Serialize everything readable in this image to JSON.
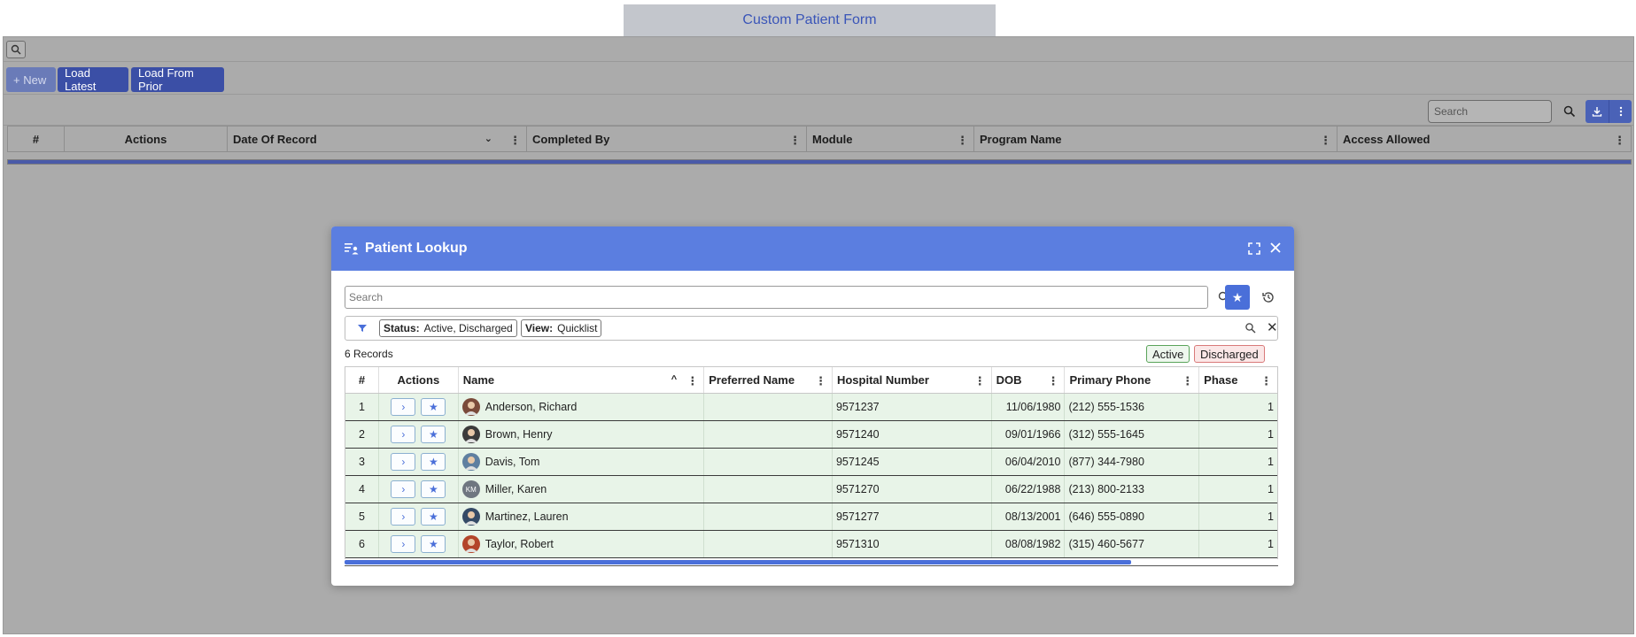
{
  "page": {
    "title": "Custom Patient Form"
  },
  "toolbar": {
    "new_label": "+ New",
    "load_latest_label": "Load Latest",
    "load_prior_label": "Load From Prior",
    "search_placeholder": "Search"
  },
  "records_grid": {
    "columns": [
      "#",
      "Actions",
      "Date Of Record",
      "Completed By",
      "Module",
      "Program Name",
      "Access Allowed"
    ]
  },
  "dialog": {
    "title": "Patient Lookup",
    "search_placeholder": "Search",
    "filters": [
      {
        "key": "Status:",
        "value": "Active, Discharged"
      },
      {
        "key": "View:",
        "value": "Quicklist"
      }
    ],
    "record_count": "6 Records",
    "legend": {
      "active": "Active",
      "discharged": "Discharged"
    },
    "columns": [
      "#",
      "Actions",
      "Name",
      "Preferred Name",
      "Hospital Number",
      "DOB",
      "Primary Phone",
      "Phase"
    ],
    "rows": [
      {
        "num": "1",
        "name": "Anderson, Richard",
        "preferred": "",
        "hospital": "9571237",
        "dob": "11/06/1980",
        "phone": "(212) 555-1536",
        "phase": "1",
        "avatar": "photo",
        "avatar_color": "#7a4a3a",
        "initials": ""
      },
      {
        "num": "2",
        "name": "Brown, Henry",
        "preferred": "",
        "hospital": "9571240",
        "dob": "09/01/1966",
        "phone": "(312) 555-1645",
        "phase": "1",
        "avatar": "photo",
        "avatar_color": "#3b3b3b",
        "initials": ""
      },
      {
        "num": "3",
        "name": "Davis, Tom",
        "preferred": "",
        "hospital": "9571245",
        "dob": "06/04/2010",
        "phone": "(877) 344-7980",
        "phase": "1",
        "avatar": "photo",
        "avatar_color": "#5f7fa0",
        "initials": ""
      },
      {
        "num": "4",
        "name": "Miller, Karen",
        "preferred": "",
        "hospital": "9571270",
        "dob": "06/22/1988",
        "phone": "(213) 800-2133",
        "phase": "1",
        "avatar": "initials",
        "avatar_color": "#6f7680",
        "initials": "KM"
      },
      {
        "num": "5",
        "name": "Martinez, Lauren",
        "preferred": "",
        "hospital": "9571277",
        "dob": "08/13/2001",
        "phone": "(646) 555-0890",
        "phase": "1",
        "avatar": "photo",
        "avatar_color": "#344a66",
        "initials": ""
      },
      {
        "num": "6",
        "name": "Taylor, Robert",
        "preferred": "",
        "hospital": "9571310",
        "dob": "08/08/1982",
        "phone": "(315) 460-5677",
        "phase": "1",
        "avatar": "photo",
        "avatar_color": "#b3452a",
        "initials": ""
      }
    ]
  },
  "colors": {
    "accent": "#5b7ee0",
    "active_row": "#e8f4e8",
    "active_badge_border": "#5aa35a",
    "discharged_badge_border": "#d97a7a"
  }
}
